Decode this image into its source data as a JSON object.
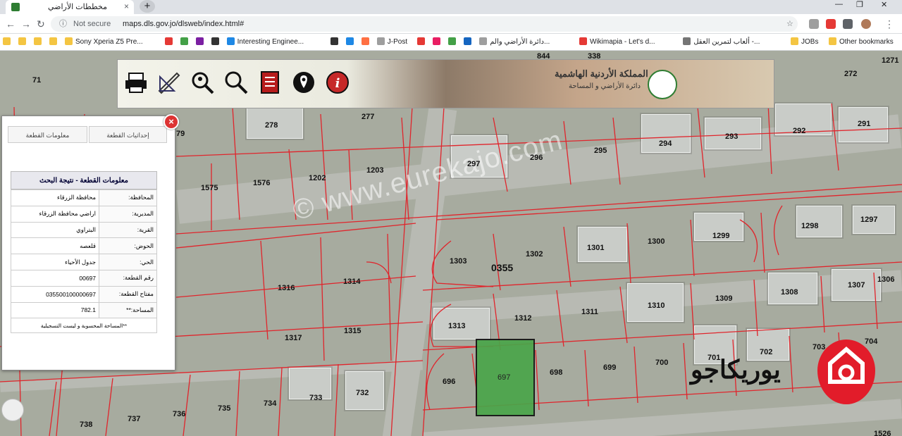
{
  "browser": {
    "tab_title": "مخططات الأراضي",
    "tab_close": "×",
    "new_tab": "+",
    "security": "Not secure",
    "url": "maps.dls.gov.jo/dlsweb/index.html#",
    "window_controls": [
      "—",
      "❐",
      "✕"
    ]
  },
  "bookmarks": [
    {
      "label": "",
      "color": "#f4c542"
    },
    {
      "label": "",
      "color": "#f4c542"
    },
    {
      "label": "",
      "color": "#f4c542"
    },
    {
      "label": "",
      "color": "#f4c542"
    },
    {
      "label": "Sony Xperia Z5 Pre...",
      "color": "#f4c542"
    },
    {
      "label": "",
      "color": "#e53935"
    },
    {
      "label": "",
      "color": "#43a047"
    },
    {
      "label": "",
      "color": "#7b1fa2"
    },
    {
      "label": "",
      "color": "#333333"
    },
    {
      "label": "Interesting Enginee...",
      "color": "#1e88e5"
    },
    {
      "label": "",
      "color": "#333333"
    },
    {
      "label": "",
      "color": "#1e88e5"
    },
    {
      "label": "",
      "color": "#ff7043"
    },
    {
      "label": "J-Post",
      "color": "#9e9e9e"
    },
    {
      "label": "",
      "color": "#e53935"
    },
    {
      "label": "",
      "color": "#e91e63"
    },
    {
      "label": "",
      "color": "#43a047"
    },
    {
      "label": "",
      "color": "#1565c0"
    },
    {
      "label": "دائرة الأراضي والم...",
      "color": "#9e9e9e"
    },
    {
      "label": "Wikimapia - Let's d...",
      "color": "#e53935"
    },
    {
      "label": "ألعاب لتمرين العقل -...",
      "color": "#757575"
    },
    {
      "label": "JOBs",
      "color": "#f4c542"
    },
    {
      "label": "Other bookmarks",
      "color": "#f4c542"
    }
  ],
  "banner": {
    "title": "المملكة الأردنية الهاشمية",
    "subtitle": "دائرة الأراضي و المساحة",
    "tools": [
      "printer-icon",
      "measure-icon",
      "locate-search-icon",
      "search-icon",
      "document-icon",
      "location-pin-icon",
      "info-icon"
    ]
  },
  "panel": {
    "close": "×",
    "tabs": {
      "info": "معلومات القطعة",
      "coords": "إحداثيات القطعة"
    },
    "result_title": "معلومات القطعة - نتيجة البحث",
    "rows": [
      {
        "key": "المحافظة:",
        "value": "محافظة الزرقاء"
      },
      {
        "key": "المديرية:",
        "value": "اراضي محافظة الزرقاء"
      },
      {
        "key": "القرية:",
        "value": "البتراوي"
      },
      {
        "key": "الحوض:",
        "value": "قلعصه"
      },
      {
        "key": "الحي:",
        "value": "جدول الأحياء"
      },
      {
        "key": "رقم القطعة:",
        "value": "00697"
      },
      {
        "key": "مفتاح القطعة:",
        "value": "035500100000697"
      },
      {
        "key": "المساحة:**",
        "value": "782.1"
      }
    ],
    "note": "**المساحة المحسوبة و ليست التسجيلية"
  },
  "map": {
    "watermark": "© www.eurekajo.com",
    "logo_text": "يوريكاجو",
    "parcels": {
      "p71": "71",
      "p278": "278",
      "p277": "277",
      "p79": "79",
      "p844": "844",
      "p338": "338",
      "p272": "272",
      "p1271": "1271",
      "p293": "293",
      "p292": "292",
      "p291": "291",
      "p294": "294",
      "p295": "295",
      "p296": "296",
      "p297": "297",
      "p1575": "1575",
      "p1576": "1576",
      "p1202": "1202",
      "p1203": "1203",
      "p1298": "1298",
      "p1297": "1297",
      "p1299": "1299",
      "p1300": "1300",
      "p1301": "1301",
      "p1302": "1302",
      "p1303": "1303",
      "block": "0355",
      "p1316": "1316",
      "p1314": "1314",
      "p1315": "1315",
      "p1317": "1317",
      "p1308": "1308",
      "p1307": "1307",
      "p1306": "1306",
      "p1309": "1309",
      "p1310": "1310",
      "p1311": "1311",
      "p1312": "1312",
      "p1313": "1313",
      "p704": "704",
      "p703": "703",
      "p702": "702",
      "p701": "701",
      "p700": "700",
      "p699": "699",
      "p698": "698",
      "p697": "697",
      "p696": "696",
      "p733": "733",
      "p732": "732",
      "p734": "734",
      "p735": "735",
      "p736": "736",
      "p737": "737",
      "p738": "738",
      "p1526": "1526"
    }
  }
}
